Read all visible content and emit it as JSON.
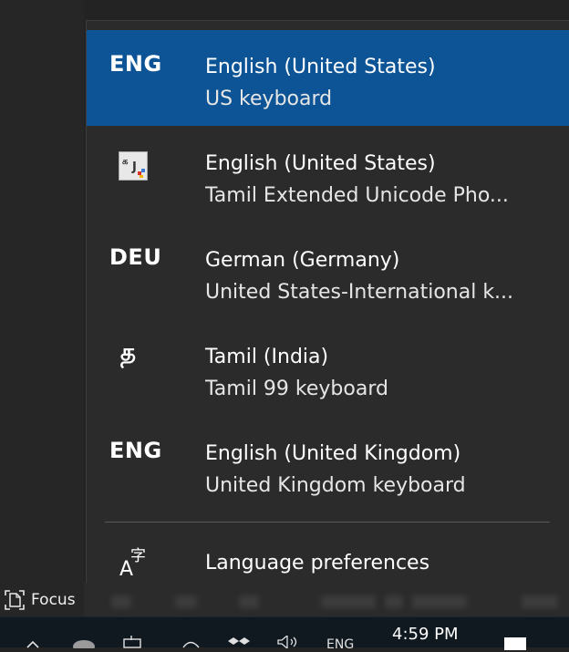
{
  "languages": [
    {
      "code": "ENG",
      "name": "English (United States)",
      "keyboard": "US keyboard",
      "selected": true
    },
    {
      "icon": "ime-keyboard-icon",
      "name": "English (United States)",
      "keyboard": "Tamil Extended Unicode Pho..."
    },
    {
      "code": "DEU",
      "name": "German (Germany)",
      "keyboard": "United States-International k..."
    },
    {
      "code": "த",
      "name": "Tamil (India)",
      "keyboard": "Tamil 99 keyboard"
    },
    {
      "code": "ENG",
      "name": "English (United Kingdom)",
      "keyboard": "United Kingdom keyboard"
    }
  ],
  "language_preferences": {
    "label": "Language preferences",
    "icon": "language-preferences-icon"
  },
  "focus": {
    "label": "Focus",
    "icon": "focus-icon"
  },
  "taskbar": {
    "input_indicator": "ENG",
    "clock": "4:59 PM",
    "tray_icons": [
      "chevron-up-icon",
      "onedrive-icon",
      "power-icon",
      "wifi-icon",
      "dropbox-icon",
      "volume-icon",
      "notifications-icon"
    ]
  },
  "colors": {
    "selected_bg": "#0c5495",
    "flyout_bg": "#2b2b2b",
    "taskbar_bg": "#101820"
  }
}
